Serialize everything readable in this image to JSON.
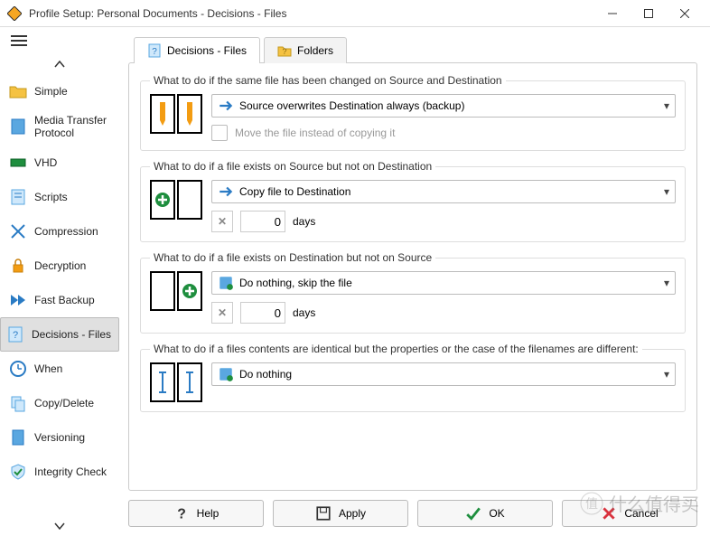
{
  "window": {
    "title": "Profile Setup: Personal Documents - Decisions - Files"
  },
  "tabs": {
    "files": "Decisions - Files",
    "folders": "Folders"
  },
  "sidebar": {
    "items": [
      {
        "label": "Simple"
      },
      {
        "label": "Media Transfer Protocol"
      },
      {
        "label": "VHD"
      },
      {
        "label": "Scripts"
      },
      {
        "label": "Compression"
      },
      {
        "label": "Decryption"
      },
      {
        "label": "Fast Backup"
      },
      {
        "label": "Decisions - Files"
      },
      {
        "label": "When"
      },
      {
        "label": "Copy/Delete"
      },
      {
        "label": "Versioning"
      },
      {
        "label": "Integrity Check"
      }
    ]
  },
  "sections": {
    "both_changed": {
      "legend": "What to do if the same file has been changed on Source and Destination",
      "select_value": "Source overwrites Destination always (backup)",
      "move_label": "Move the file instead of copying it"
    },
    "only_source": {
      "legend": "What to do if a file exists on Source but not on Destination",
      "select_value": "Copy file to Destination",
      "days_value": "0",
      "days_label": "days"
    },
    "only_dest": {
      "legend": "What to do if a file exists on Destination but not on Source",
      "select_value": "Do nothing, skip the file",
      "days_value": "0",
      "days_label": "days"
    },
    "identical": {
      "legend": "What to do if a files contents are identical but the properties or the case of the filenames are different:",
      "select_value": "Do nothing"
    }
  },
  "buttons": {
    "help": "Help",
    "apply": "Apply",
    "ok": "OK",
    "cancel": "Cancel"
  },
  "watermark": "什么值得买"
}
